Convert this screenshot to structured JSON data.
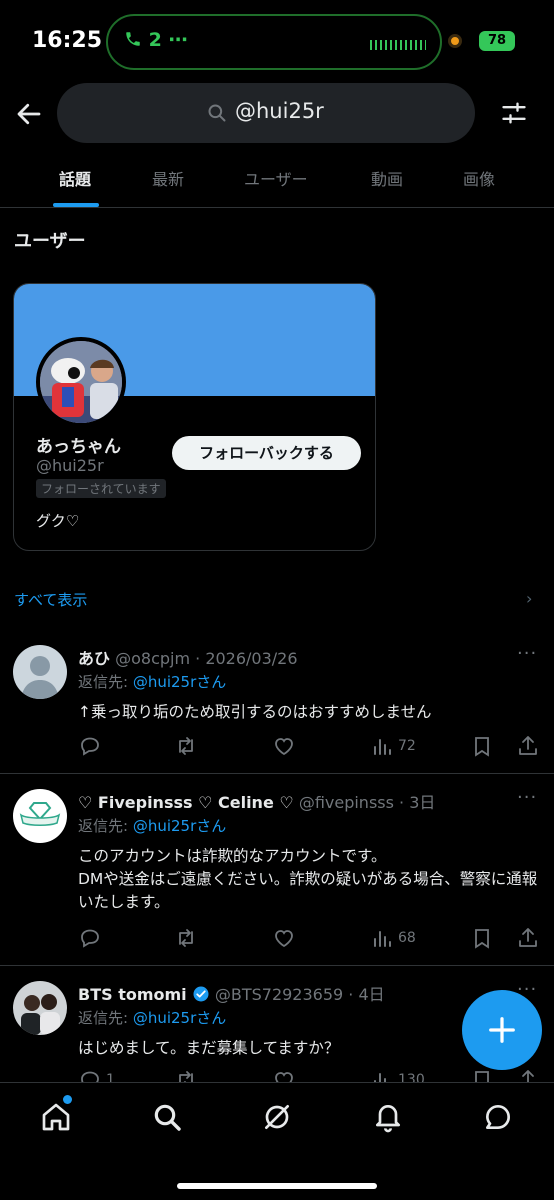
{
  "status_bar": {
    "time": "16:25",
    "call_label": "2 ⋯",
    "battery": "78"
  },
  "search": {
    "query": "@hui25r"
  },
  "tabs": [
    {
      "label": "話題",
      "active": true
    },
    {
      "label": "最新",
      "active": false
    },
    {
      "label": "ユーザー",
      "active": false
    },
    {
      "label": "動画",
      "active": false
    },
    {
      "label": "画像",
      "active": false
    }
  ],
  "users_section": {
    "title": "ユーザー",
    "card": {
      "name": "あっちゃん",
      "handle": "@hui25r",
      "follows_you": "フォローされています",
      "bio": "グク♡",
      "follow_button": "フォローバックする"
    },
    "show_all": "すべて表示"
  },
  "tweets": [
    {
      "name": "あひ",
      "meta": "@o8cpjm · 2026/03/26",
      "reply_prefix": "返信先: ",
      "reply_to": "@hui25rさん",
      "text": "↑乗っ取り垢のため取引するのはおすすめしません",
      "views": "72"
    },
    {
      "name": "♡ Fivepinsss ♡ Celine ♡",
      "meta": "@fivepinsss · 3日",
      "reply_prefix": "返信先: ",
      "reply_to": "@hui25rさん",
      "text": "このアカウントは詐欺的なアカウントです。\nDMや送金はご遠慮ください。詐欺の疑いがある場合、警察に通報いたします。",
      "views": "68"
    },
    {
      "name": "BTS tomomi",
      "meta": "@BTS72923659 · 4日",
      "reply_prefix": "返信先: ",
      "reply_to": "@hui25rさん",
      "text": "はじめまして。まだ募集してますか？",
      "reply_count": "1",
      "views": "130"
    }
  ],
  "colors": {
    "accent": "#1d9bf0",
    "banner": "#4a9ae8",
    "muted": "#71767b"
  },
  "icons": [
    "back-arrow-icon",
    "search-icon",
    "filter-icon",
    "reply-icon",
    "retweet-icon",
    "like-icon",
    "views-icon",
    "bookmark-icon",
    "share-icon",
    "compose-icon",
    "home-icon",
    "explore-icon",
    "grok-icon",
    "notifications-icon",
    "messages-icon"
  ]
}
